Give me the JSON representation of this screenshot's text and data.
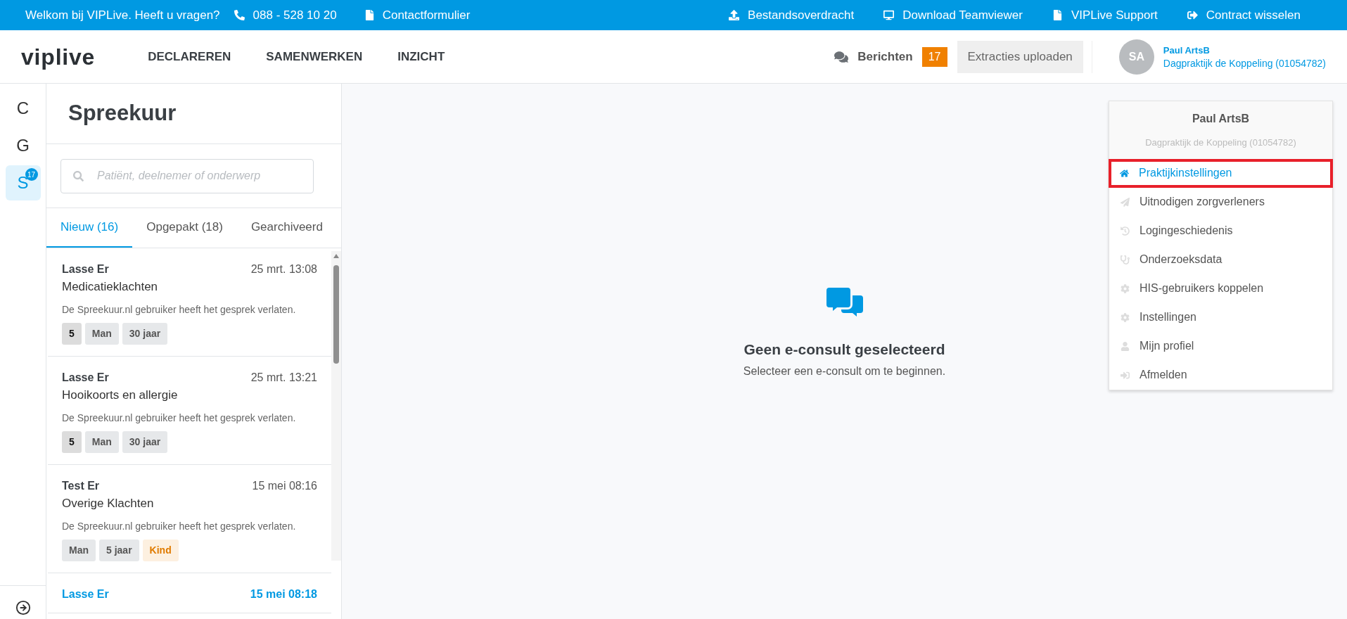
{
  "top_bar": {
    "welcome": "Welkom bij VIPLive. Heeft u vragen?",
    "phone": "088 - 528 10 20",
    "contact": "Contactformulier",
    "links": [
      "Bestandsoverdracht",
      "Download Teamviewer",
      "VIPLive Support",
      "Contract wisselen"
    ]
  },
  "header": {
    "logo": "viplive",
    "nav": [
      {
        "label": "DECLAREREN",
        "selected": false
      },
      {
        "label": "SAMENWERKEN",
        "selected": false
      },
      {
        "label": "INZICHT",
        "selected": false
      }
    ],
    "messages": {
      "label": "Berichten",
      "count": "17"
    },
    "upload_button": "Extracties uploaden",
    "user": {
      "initials": "SA",
      "name": "Paul ArtsB",
      "practice": "Dagpraktijk de Koppeling (01054782)"
    }
  },
  "rail": {
    "items": [
      {
        "label": "C",
        "selected": false
      },
      {
        "label": "G",
        "selected": false
      },
      {
        "label": "S",
        "selected": true,
        "badge": "17"
      }
    ]
  },
  "list_panel": {
    "title": "Spreekuur",
    "search": {
      "placeholder": "Patiënt, deelnemer of onderwerp"
    },
    "tabs": [
      {
        "label": "Nieuw (16)",
        "selected": true
      },
      {
        "label": "Opgepakt (18)",
        "selected": false
      },
      {
        "label": "Gearchiveerd",
        "selected": false
      }
    ],
    "items": [
      {
        "name": "Lasse Er",
        "time": "25 mrt. 13:08",
        "subject": "Medicatieklachten",
        "message": "De Spreekuur.nl gebruiker heeft het gesprek verlaten.",
        "unread": false,
        "tags": [
          {
            "text": "5",
            "kind": "count"
          },
          {
            "text": "Man",
            "kind": "plain"
          },
          {
            "text": "30 jaar",
            "kind": "plain"
          }
        ]
      },
      {
        "name": "Lasse Er",
        "time": "25 mrt. 13:21",
        "subject": "Hooikoorts en allergie",
        "message": "De Spreekuur.nl gebruiker heeft het gesprek verlaten.",
        "unread": false,
        "tags": [
          {
            "text": "5",
            "kind": "count"
          },
          {
            "text": "Man",
            "kind": "plain"
          },
          {
            "text": "30 jaar",
            "kind": "plain"
          }
        ]
      },
      {
        "name": "Test Er",
        "time": "15 mei 08:16",
        "subject": "Overige Klachten",
        "message": "De Spreekuur.nl gebruiker heeft het gesprek verlaten.",
        "unread": false,
        "tags": [
          {
            "text": "Man",
            "kind": "plain"
          },
          {
            "text": "5 jaar",
            "kind": "plain"
          },
          {
            "text": "Kind",
            "kind": "child"
          }
        ]
      },
      {
        "name": "Lasse Er",
        "time": "15 mei 08:18",
        "unread": true
      }
    ]
  },
  "empty_state": {
    "title": "Geen e-consult geselecteerd",
    "text": "Selecteer een e-consult om te beginnen."
  },
  "user_menu": {
    "name": "Paul ArtsB",
    "practice": "Dagpraktijk de Koppeling (01054782)",
    "items": [
      {
        "label": "Praktijkinstellingen",
        "selected": true
      },
      {
        "label": "Uitnodigen zorgverleners",
        "selected": false
      },
      {
        "label": "Logingeschiedenis",
        "selected": false
      },
      {
        "label": "Onderzoeksdata",
        "selected": false
      },
      {
        "label": "HIS-gebruikers koppelen",
        "selected": false
      },
      {
        "label": "Instellingen",
        "selected": false
      },
      {
        "label": "Mijn profiel",
        "selected": false
      },
      {
        "label": "Afmelden",
        "selected": false
      }
    ]
  }
}
